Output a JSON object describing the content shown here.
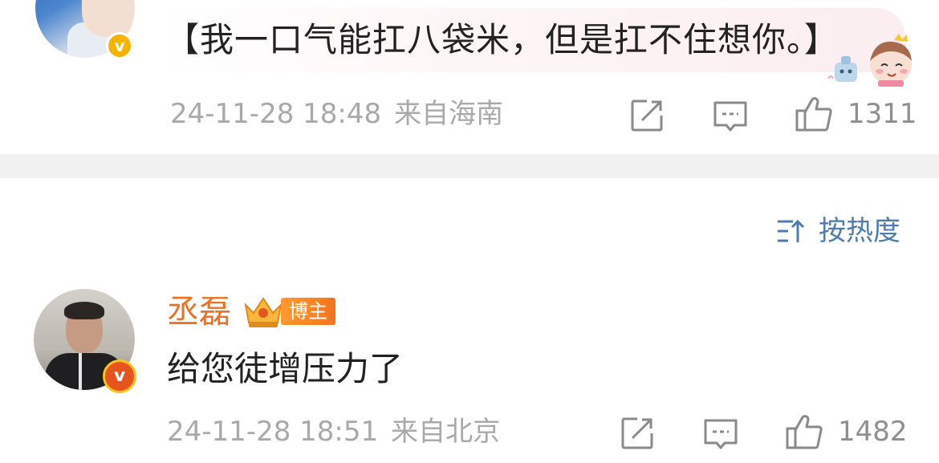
{
  "top_post": {
    "quote": "【我一口气能扛八袋米，但是扛不住想你。】",
    "timestamp": "24-11-28 18:48",
    "location": "来自海南",
    "likes": "1311"
  },
  "sort": {
    "label": "按热度"
  },
  "comment": {
    "author": "丞磊",
    "badge": "博主",
    "text": "给您徒增压力了",
    "timestamp": "24-11-28 18:51",
    "location": "来自北京",
    "likes": "1482"
  },
  "icons": {
    "share": "share-icon",
    "comment": "comment-icon",
    "like": "thumbs-up-icon",
    "sort": "sort-icon",
    "verified": "verified-badge-icon",
    "crown": "crown-icon"
  },
  "colors": {
    "meta_gray": "#a9a9a9",
    "sort_blue": "#4f7cb0",
    "author_orange": "#eb7224",
    "verified_yellow": "#f6b400",
    "divider": "#f1f1f1"
  }
}
